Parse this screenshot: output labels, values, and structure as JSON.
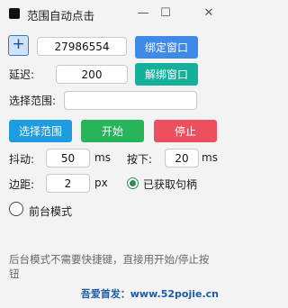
{
  "window": {
    "title": "范围自动点击",
    "min": "—",
    "max": "☐",
    "close": "✕"
  },
  "handle_row": {
    "plus": "+",
    "handle_value": "27986554",
    "bind_label": "绑定窗口"
  },
  "delay_row": {
    "label": "延迟:",
    "value": "200",
    "unbind_label": "解绑窗口"
  },
  "range_row": {
    "label": "选择范围:",
    "value": ""
  },
  "actions": {
    "select_range": "选择范围",
    "start": "开始",
    "stop": "停止"
  },
  "jitter": {
    "label": "抖动:",
    "value": "50",
    "unit": "ms"
  },
  "press": {
    "label": "按下:",
    "value": "20",
    "unit": "ms"
  },
  "margin": {
    "label": "边距:",
    "value": "2",
    "unit": "px"
  },
  "handle_status": "已获取句柄",
  "foreground_mode": "前台模式",
  "hint": "后台模式不需要快捷键，直接用开始/停止按钮",
  "credit": "吾爱首发：www.52pojie.cn",
  "colors": {
    "blue": "#3f8ae8",
    "teal": "#15b09a",
    "sky": "#1f9be0",
    "green": "#27b45a",
    "red": "#ee4f5f",
    "status_green": "#2e8b57"
  }
}
